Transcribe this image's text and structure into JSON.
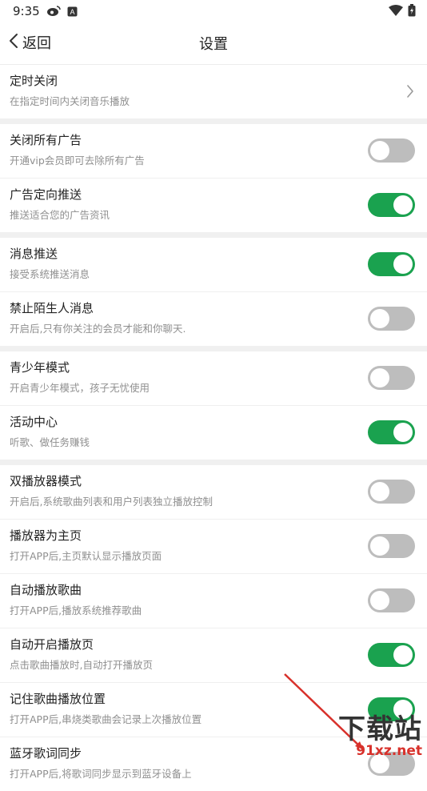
{
  "status_bar": {
    "time": "9:35"
  },
  "header": {
    "back_label": "返回",
    "title": "设置"
  },
  "groups": [
    {
      "items": [
        {
          "title": "定时关闭",
          "desc": "在指定时间内关闭音乐播放",
          "control": "chevron"
        }
      ]
    },
    {
      "items": [
        {
          "title": "关闭所有广告",
          "desc": "开通vip会员即可去除所有广告",
          "control": "toggle",
          "state": "off"
        },
        {
          "title": "广告定向推送",
          "desc": "推送适合您的广告资讯",
          "control": "toggle",
          "state": "on"
        }
      ]
    },
    {
      "items": [
        {
          "title": "消息推送",
          "desc": "接受系统推送消息",
          "control": "toggle",
          "state": "on"
        },
        {
          "title": "禁止陌生人消息",
          "desc": "开启后,只有你关注的会员才能和你聊天.",
          "control": "toggle",
          "state": "off"
        }
      ]
    },
    {
      "items": [
        {
          "title": "青少年模式",
          "desc": "开启青少年模式，孩子无忧使用",
          "control": "toggle",
          "state": "off"
        },
        {
          "title": "活动中心",
          "desc": "听歌、做任务赚钱",
          "control": "toggle",
          "state": "on"
        }
      ]
    },
    {
      "items": [
        {
          "title": "双播放器模式",
          "desc": "开启后,系统歌曲列表和用户列表独立播放控制",
          "control": "toggle",
          "state": "off"
        },
        {
          "title": "播放器为主页",
          "desc": "打开APP后,主页默认显示播放页面",
          "control": "toggle",
          "state": "off"
        },
        {
          "title": "自动播放歌曲",
          "desc": "打开APP后,播放系统推荐歌曲",
          "control": "toggle",
          "state": "off"
        },
        {
          "title": "自动开启播放页",
          "desc": "点击歌曲播放时,自动打开播放页",
          "control": "toggle",
          "state": "on"
        },
        {
          "title": "记住歌曲播放位置",
          "desc": "打开APP后,串烧类歌曲会记录上次播放位置",
          "control": "toggle",
          "state": "on"
        },
        {
          "title": "蓝牙歌词同步",
          "desc": "打开APP后,将歌词同步显示到蓝牙设备上",
          "control": "toggle",
          "state": "off"
        }
      ]
    }
  ],
  "watermark": {
    "brand": "下载站",
    "domain": "91xz.net"
  },
  "colors": {
    "toggle_on": "#1aa24f",
    "toggle_off": "#bdbdbd",
    "group_gap": "#f0f0f0"
  }
}
